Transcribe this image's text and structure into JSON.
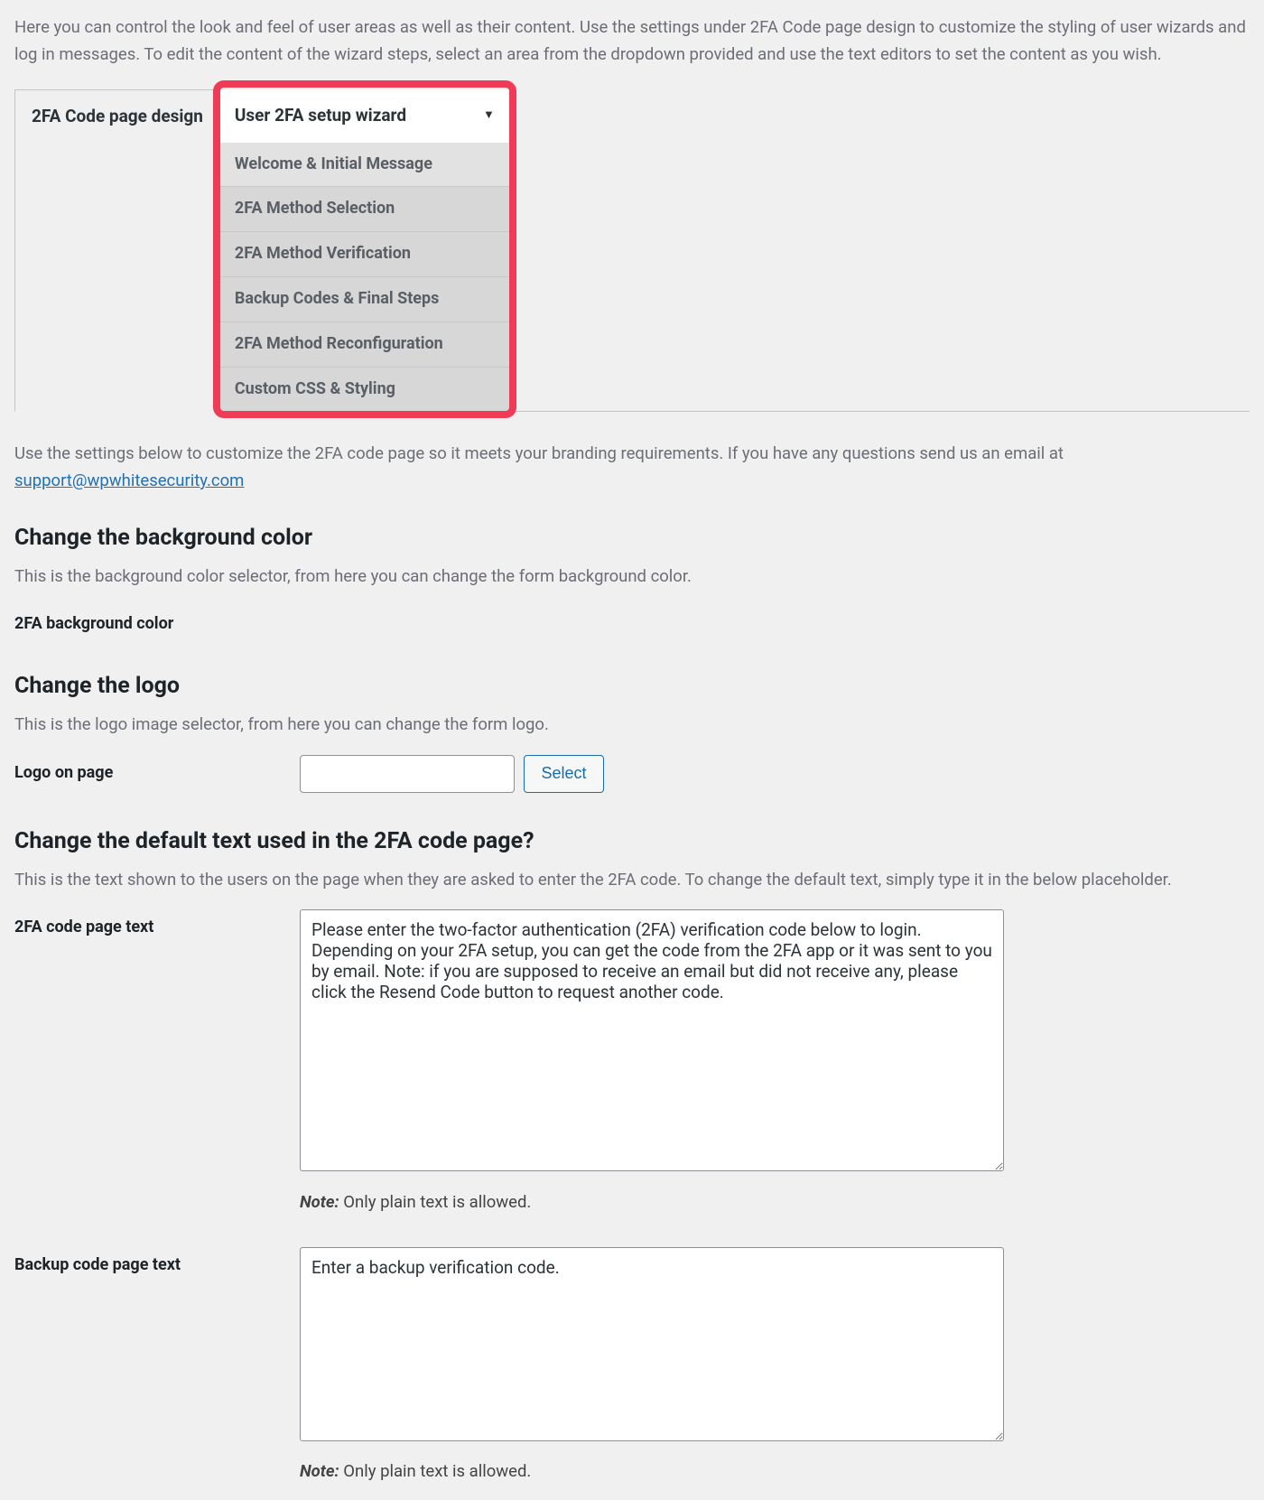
{
  "intro": "Here you can control the look and feel of user areas as well as their content. Use the settings under 2FA Code page design to customize the styling of user wizards and log in messages. To edit the content of the wizard steps, select an area from the dropdown provided and use the text editors to set the content as you wish.",
  "tabs": {
    "active": "2FA Code page design",
    "dropdown_label": "User 2FA setup wizard",
    "dropdown_items": [
      "Welcome & Initial Message",
      "2FA Method Selection",
      "2FA Method Verification",
      "Backup Codes & Final Steps",
      "2FA Method Reconfiguration",
      "Custom CSS & Styling"
    ]
  },
  "customize_desc_a": "Use the settings below to customize the 2FA code page so it meets your branding requirements. If you have any questions send us an email at ",
  "customize_email": "support@wpwhitesecurity.com",
  "sections": {
    "bg": {
      "heading": "Change the background color",
      "desc": "This is the background color selector, from here you can change the form background color.",
      "label": "2FA background color"
    },
    "logo": {
      "heading": "Change the logo",
      "desc": "This is the logo image selector, from here you can change the form logo.",
      "label": "Logo on page",
      "input_value": "",
      "select_btn": "Select"
    },
    "text": {
      "heading": "Change the default text used in the 2FA code page?",
      "desc": "This is the text shown to the users on the page when they are asked to enter the 2FA code. To change the default text, simply type it in the below placeholder.",
      "code_label": "2FA code page text",
      "code_value": "Please enter the two-factor authentication (2FA) verification code below to login. Depending on your 2FA setup, you can get the code from the 2FA app or it was sent to you by email. Note: if you are supposed to receive an email but did not receive any, please click the Resend Code button to request another code.",
      "backup_label": "Backup code page text",
      "backup_value": "Enter a backup verification code.",
      "note_label": "Note:",
      "note_text": " Only plain text is allowed."
    }
  }
}
